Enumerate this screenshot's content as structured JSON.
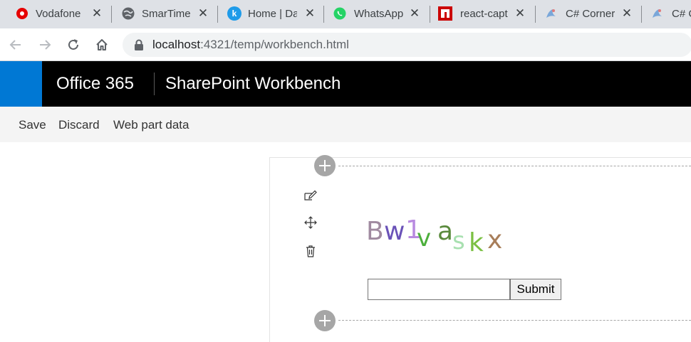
{
  "browser": {
    "tabs": [
      {
        "title": "Vodafone",
        "icon": "vodafone-icon"
      },
      {
        "title": "SmarTime",
        "icon": "globe-icon"
      },
      {
        "title": "Home | Da",
        "icon": "k-icon"
      },
      {
        "title": "WhatsApp",
        "icon": "whatsapp-icon"
      },
      {
        "title": "react-capt",
        "icon": "npm-icon"
      },
      {
        "title": "C# Corner",
        "icon": "csharpcorner-icon"
      },
      {
        "title": "C# C",
        "icon": "csharpcorner-icon"
      }
    ],
    "address": {
      "host": "localhost",
      "path": ":4321/temp/workbench.html"
    }
  },
  "suitebar": {
    "brand": "Office 365",
    "title": "SharePoint Workbench"
  },
  "commands": [
    "Save",
    "Discard",
    "Web part data"
  ],
  "webpart": {
    "captcha_chars": [
      {
        "c": "B",
        "color": "#a08aa0"
      },
      {
        "c": "w",
        "color": "#6a52b8"
      },
      {
        "c": "1",
        "color": "#b88ae0"
      },
      {
        "c": "v",
        "color": "#4caf3c"
      },
      {
        "c": "a",
        "color": "#5a8a3c"
      },
      {
        "c": "s",
        "color": "#a8e0b0"
      },
      {
        "c": "k",
        "color": "#7bc043"
      },
      {
        "c": "x",
        "color": "#a87e5a"
      }
    ],
    "input_value": "",
    "submit_label": "Submit"
  },
  "colors": {
    "suite_bg": "#000000",
    "waffle_bg": "#0078d4",
    "tabstrip_bg": "#dee1e6"
  }
}
